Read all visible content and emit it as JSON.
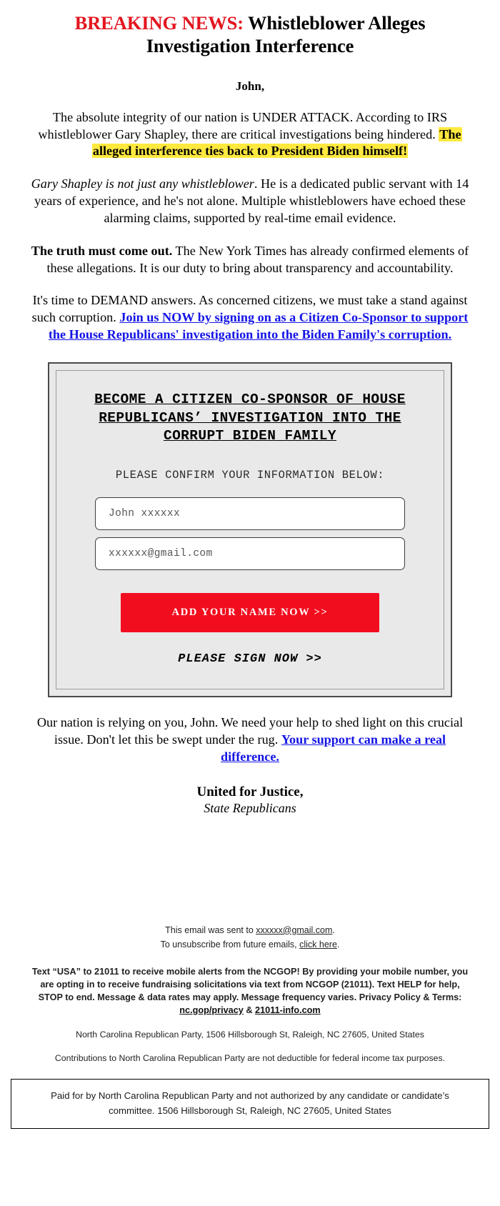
{
  "headline": {
    "breaking_label": "BREAKING NEWS:",
    "rest": " Whistleblower Alleges Investigation Interference"
  },
  "salutation": "John,",
  "paragraphs": {
    "p1_pre": "The absolute integrity of our nation is UNDER ATTACK. According to IRS whistleblower Gary Shapley, there are critical investigations being hindered. ",
    "p1_highlight": "The alleged interference ties back to President Biden himself!",
    "p2_italic": "Gary Shapley is not just any whistleblower",
    "p2_rest": ". He is a dedicated public servant with 14 years of experience, and he's not alone. Multiple whistleblowers have echoed these alarming claims, supported by real-time email evidence.",
    "p3_bold": "The truth must come out.",
    "p3_rest": " The New York Times has already confirmed elements of these allegations. It is our duty to bring about transparency and accountability.",
    "p4_pre": "It's time to DEMAND answers. As concerned citizens, we must take a stand against such corruption. ",
    "p4_link": "Join us NOW by signing on as a Citizen Co-Sponsor to support the House Republicans' investigation into the Biden Family's corruption."
  },
  "signup_card": {
    "title": "BECOME A CITIZEN CO-SPONSOR OF HOUSE REPUBLICANS’ INVESTIGATION INTO THE CORRUPT BIDEN FAMILY",
    "subtitle": "PLEASE CONFIRM YOUR INFORMATION BELOW:",
    "name_value": "John xxxxxx",
    "name_placeholder": "John xxxxxx",
    "email_value": "xxxxxx@gmail.com",
    "email_placeholder": "xxxxxx@gmail.com",
    "cta_label": "ADD YOUR NAME NOW >>",
    "sign_now_label": "PLEASE SIGN NOW >>",
    "cta_color": "#f20d1e",
    "card_background": "#e9e9e9"
  },
  "closing": {
    "pre": "Our nation is relying on you, John. We need your help to shed light on this crucial issue. Don't let this be swept under the rug. ",
    "link": "Your support can make a real difference.",
    "signoff_line1": "United for Justice,",
    "signoff_line2": "State Republicans"
  },
  "footer": {
    "sent_pre": "This email was sent to ",
    "sent_email": "xxxxxx@gmail.com",
    "sent_post": ".",
    "unsub_pre": "To unsubscribe from future emails, ",
    "unsub_link": "click here",
    "unsub_post": ".",
    "legal_part1": "Text “USA” to 21011 to receive mobile alerts from the NCGOP! By providing your mobile number, you are opting in to receive fundraising solicitations via text from NCGOP (21011). Text HELP for help, STOP to end. Message & data rates may apply. Message frequency varies. Privacy Policy & Terms: ",
    "legal_link1": "nc.gop/privacy",
    "legal_amp": " & ",
    "legal_link2": "21011-info.com",
    "address": "North Carolina Republican Party, 1506 Hillsborough St, Raleigh, NC 27605, United States",
    "contributions": "Contributions to North Carolina Republican Party are not deductible for federal income tax purposes.",
    "paid_for": "Paid for by North Carolina Republican Party and not authorized by any candidate or candidate’s committee. 1506 Hillsborough St, Raleigh, NC 27605, United States"
  },
  "colors": {
    "breaking_red": "#e3151e",
    "link_blue": "#1414e6",
    "highlight_yellow": "#ffe93f"
  }
}
